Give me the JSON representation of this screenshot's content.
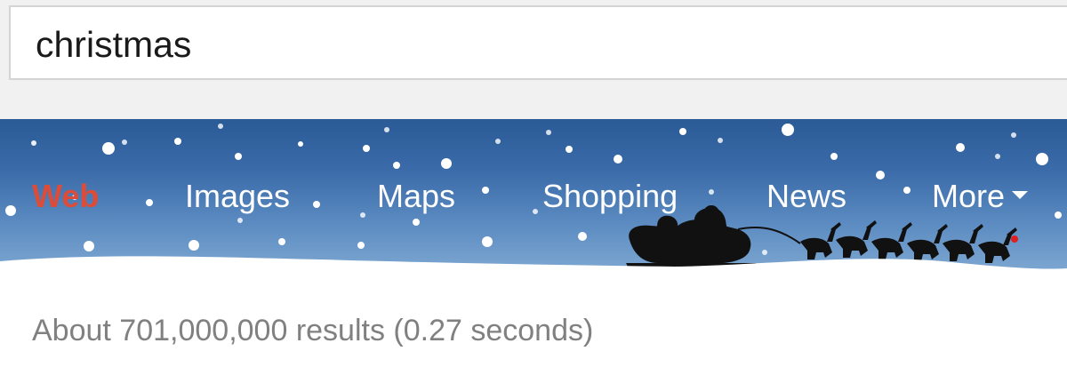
{
  "search": {
    "query": "christmas"
  },
  "nav": {
    "items": [
      {
        "label": "Web",
        "active": true
      },
      {
        "label": "Images",
        "active": false
      },
      {
        "label": "Maps",
        "active": false
      },
      {
        "label": "Shopping",
        "active": false
      },
      {
        "label": "News",
        "active": false
      },
      {
        "label": "More",
        "active": false
      }
    ],
    "more_icon": "caret-down-icon",
    "banner_decoration": "snowfall-with-santa-sleigh-and-reindeer"
  },
  "results": {
    "stats": "About 701,000,000 results (0.27 seconds)"
  },
  "colors": {
    "active_tab": "#dd4b39",
    "banner_top": "#2b5b96",
    "banner_bottom": "#86aed6",
    "stats_text": "#808080",
    "reindeer_nose": "#e02020"
  }
}
